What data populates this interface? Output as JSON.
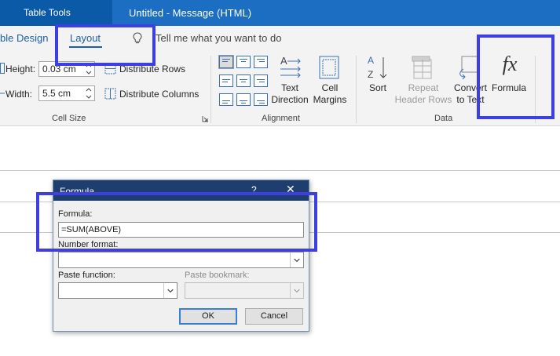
{
  "titlebar": {
    "context_tab": "Table Tools",
    "document_title": "Untitled  -  Message (HTML)"
  },
  "tabs": {
    "design": "ble Design",
    "layout": "Layout",
    "tell_me": "Tell me what you want to do"
  },
  "cell_size": {
    "height_label": "Height:",
    "height_value": "0.03 cm",
    "width_label": "Width:",
    "width_value": "5.5 cm",
    "distribute_rows": "Distribute Rows",
    "distribute_columns": "Distribute Columns",
    "group_label": "Cell Size"
  },
  "alignment": {
    "text_direction_line1": "Text",
    "text_direction_line2": "Direction",
    "cell_margins_line1": "Cell",
    "cell_margins_line2": "Margins",
    "group_label": "Alignment"
  },
  "data_group": {
    "sort": "Sort",
    "repeat_header_line1": "Repeat",
    "repeat_header_line2": "Header Rows",
    "convert_line1": "Convert",
    "convert_line2": "to Text",
    "formula_symbol": "fx",
    "formula": "Formula",
    "group_label": "Data"
  },
  "dialog": {
    "title": "Formula",
    "help": "?",
    "close": "✕",
    "formula_label": "Formula:",
    "formula_value": "=SUM(ABOVE)",
    "number_format_label": "Number format:",
    "number_format_value": "",
    "paste_function_label": "Paste function:",
    "paste_function_value": "",
    "paste_bookmark_label": "Paste bookmark:",
    "paste_bookmark_value": "",
    "ok": "OK",
    "cancel": "Cancel"
  },
  "colors": {
    "title_bar": "#1b6ec2",
    "highlight": "#3d3fe0",
    "dialog_title": "#1e3f6e",
    "accent": "#1e5fa8"
  }
}
